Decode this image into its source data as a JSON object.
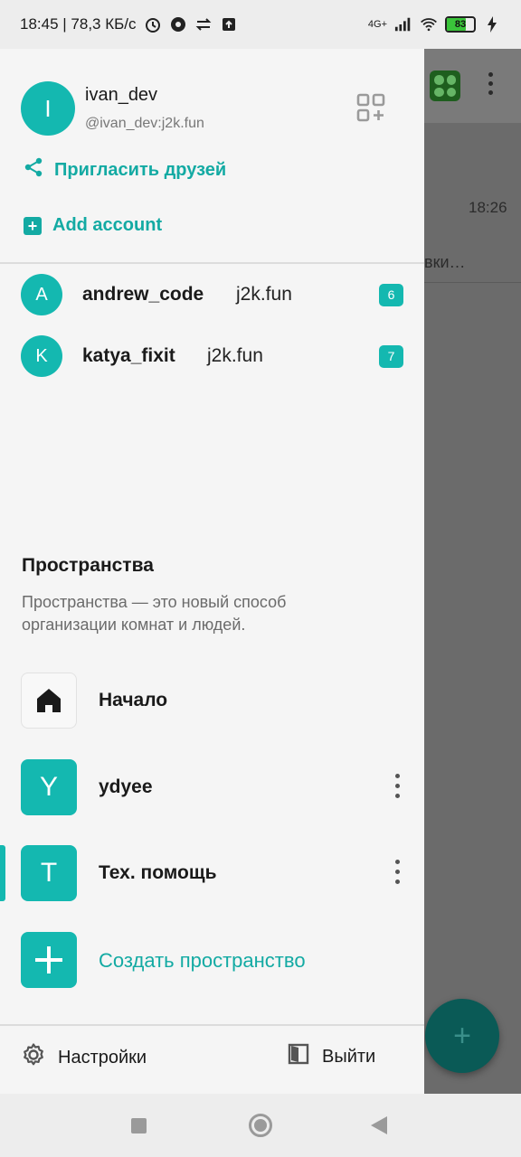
{
  "status_bar": {
    "time_speed": "18:45 | 78,3 КБ/с",
    "network": "4G+",
    "battery": "83"
  },
  "background_app": {
    "time": "18:26",
    "snippet": "вки…",
    "fab_label": "+"
  },
  "drawer": {
    "profile": {
      "initial": "I",
      "name": "ivan_dev",
      "handle": "@ivan_dev:j2k.fun"
    },
    "invite_label": "Пригласить друзей",
    "add_account_label": "Add account",
    "accounts": [
      {
        "initial": "A",
        "name": "andrew_code",
        "server": "j2k.fun",
        "badge": "6"
      },
      {
        "initial": "K",
        "name": "katya_fixit",
        "server": "j2k.fun",
        "badge": "7"
      }
    ],
    "spaces": {
      "title": "Пространства",
      "description": "Пространства — это новый способ организации комнат и людей.",
      "items": [
        {
          "label": "Начало",
          "icon": "home-icon"
        },
        {
          "initial": "Y",
          "label": "ydyee"
        },
        {
          "initial": "T",
          "label": "Тех. помощь"
        }
      ],
      "create_label": "Создать пространство"
    },
    "footer": {
      "settings_label": "Настройки",
      "logout_label": "Выйти"
    }
  },
  "colors": {
    "accent": "#14b8b0",
    "accent_text": "#13aaa3"
  }
}
